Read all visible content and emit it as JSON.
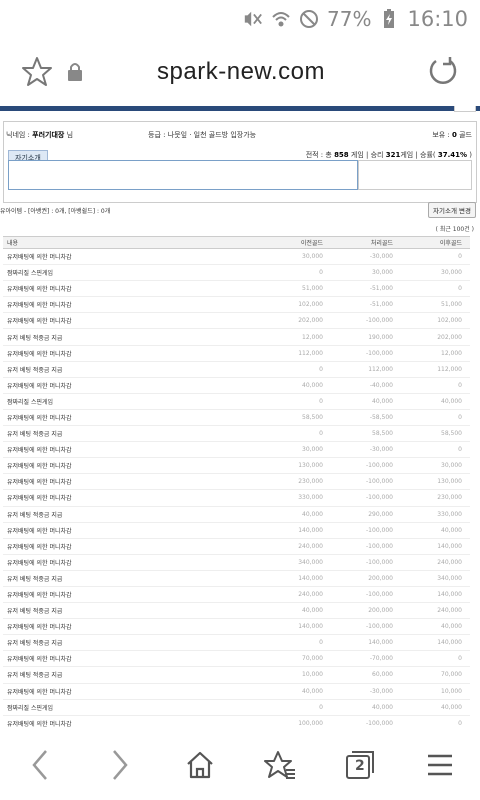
{
  "status": {
    "battery": "77%",
    "time": "16:10"
  },
  "browser": {
    "host": "spark-new.com",
    "tab_count": "2"
  },
  "profile": {
    "nick_label": "닉네임 : ",
    "nick_value": "푸러기대장",
    "nick_suffix": " 님",
    "grade_text": "등급 : 나뭇잎 · 일천 골드방 입장가능",
    "hold_label": "보유 : ",
    "hold_value": "0",
    "hold_suffix": " 골드",
    "record_prefix": "전적 : 총 ",
    "total": "858",
    "record_mid1": " 게임 | 승리 ",
    "wins": "321",
    "record_mid2": "게임 | 승률( ",
    "rate": "37.41%",
    "record_suffix": " )",
    "intro_tab": "자기소개"
  },
  "items": {
    "text": "유아이템 - [아뱅권] : 0개, [아뱅쉴드] : 0개",
    "button": "자기소개 변경"
  },
  "recent_label": "( 최근 100건 )",
  "table": {
    "headers": [
      "내용",
      "이전골드",
      "처리골드",
      "이후골드"
    ],
    "rows": [
      [
        "유저배팅에 의한 머니차감",
        "30,000",
        "-30,000",
        "0"
      ],
      [
        "짬짜리질 스핀게임",
        "0",
        "30,000",
        "30,000"
      ],
      [
        "유저배팅에 의한 머니차감",
        "51,000",
        "-51,000",
        "0"
      ],
      [
        "유저배팅에 의한 머니차감",
        "102,000",
        "-51,000",
        "51,000"
      ],
      [
        "유저배팅에 의한 머니차감",
        "202,000",
        "-100,000",
        "102,000"
      ],
      [
        "유저 베팅 적중금 지급",
        "12,000",
        "190,000",
        "202,000"
      ],
      [
        "유저배팅에 의한 머니차감",
        "112,000",
        "-100,000",
        "12,000"
      ],
      [
        "유저 베팅 적중금 지급",
        "0",
        "112,000",
        "112,000"
      ],
      [
        "유저배팅에 의한 머니차감",
        "40,000",
        "-40,000",
        "0"
      ],
      [
        "짬짜리질 스핀게임",
        "0",
        "40,000",
        "40,000"
      ],
      [
        "유저배팅에 의한 머니차감",
        "58,500",
        "-58,500",
        "0"
      ],
      [
        "유저 베팅 적중금 지급",
        "0",
        "58,500",
        "58,500"
      ],
      [
        "유저배팅에 의한 머니차감",
        "30,000",
        "-30,000",
        "0"
      ],
      [
        "유저배팅에 의한 머니차감",
        "130,000",
        "-100,000",
        "30,000"
      ],
      [
        "유저배팅에 의한 머니차감",
        "230,000",
        "-100,000",
        "130,000"
      ],
      [
        "유저배팅에 의한 머니차감",
        "330,000",
        "-100,000",
        "230,000"
      ],
      [
        "유저 베팅 적중금 지급",
        "40,000",
        "290,000",
        "330,000"
      ],
      [
        "유저배팅에 의한 머니차감",
        "140,000",
        "-100,000",
        "40,000"
      ],
      [
        "유저배팅에 의한 머니차감",
        "240,000",
        "-100,000",
        "140,000"
      ],
      [
        "유저배팅에 의한 머니차감",
        "340,000",
        "-100,000",
        "240,000"
      ],
      [
        "유저 베팅 적중금 지급",
        "140,000",
        "200,000",
        "340,000"
      ],
      [
        "유저배팅에 의한 머니차감",
        "240,000",
        "-100,000",
        "140,000"
      ],
      [
        "유저 베팅 적중금 지급",
        "40,000",
        "200,000",
        "240,000"
      ],
      [
        "유저배팅에 의한 머니차감",
        "140,000",
        "-100,000",
        "40,000"
      ],
      [
        "유저 베팅 적중금 지급",
        "0",
        "140,000",
        "140,000"
      ],
      [
        "유저배팅에 의한 머니차감",
        "70,000",
        "-70,000",
        "0"
      ],
      [
        "유저 베팅 적중금 지급",
        "10,000",
        "60,000",
        "70,000"
      ],
      [
        "유저배팅에 의한 머니차감",
        "40,000",
        "-30,000",
        "10,000"
      ],
      [
        "짬짜리질 스핀게임",
        "0",
        "40,000",
        "40,000"
      ],
      [
        "유저배팅에 의한 머니차감",
        "100,000",
        "-100,000",
        "0"
      ]
    ]
  }
}
